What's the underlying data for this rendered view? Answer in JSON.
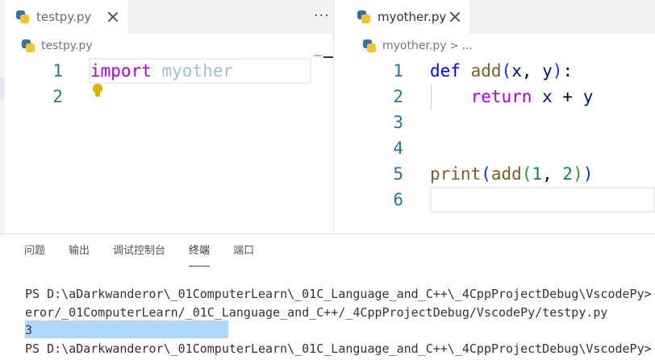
{
  "left_editor": {
    "tab_title": "testpy.py",
    "breadcrumb_file": "testpy.py",
    "more_icon": "···",
    "lines": [
      {
        "num": "1",
        "tokens": [
          {
            "t": "import",
            "c": "k-import"
          },
          {
            "t": " ",
            "c": ""
          },
          {
            "t": "myother",
            "c": "k-mod"
          }
        ]
      },
      {
        "num": "2",
        "tokens": []
      }
    ]
  },
  "right_editor": {
    "tab_title": "myother.py",
    "breadcrumb_file": "myother.py",
    "breadcrumb_sep": ">",
    "breadcrumb_more": "...",
    "lines": [
      {
        "num": "1",
        "tokens": [
          {
            "t": "def",
            "c": "k-def"
          },
          {
            "t": " ",
            "c": ""
          },
          {
            "t": "add",
            "c": "k-fn"
          },
          {
            "t": "(",
            "c": "k-paren1"
          },
          {
            "t": "x",
            "c": "k-var"
          },
          {
            "t": ", ",
            "c": "k-op"
          },
          {
            "t": "y",
            "c": "k-var"
          },
          {
            "t": ")",
            "c": "k-paren1"
          },
          {
            "t": ":",
            "c": "k-op"
          }
        ]
      },
      {
        "num": "2",
        "tokens": [
          {
            "t": "    ",
            "c": ""
          },
          {
            "t": "return",
            "c": "k-ret"
          },
          {
            "t": " ",
            "c": ""
          },
          {
            "t": "x",
            "c": "k-var"
          },
          {
            "t": " + ",
            "c": "k-op"
          },
          {
            "t": "y",
            "c": "k-var"
          }
        ]
      },
      {
        "num": "3",
        "tokens": []
      },
      {
        "num": "4",
        "tokens": []
      },
      {
        "num": "5",
        "tokens": [
          {
            "t": "print",
            "c": "k-fn"
          },
          {
            "t": "(",
            "c": "k-paren1"
          },
          {
            "t": "add",
            "c": "k-fn"
          },
          {
            "t": "(",
            "c": "k-paren2"
          },
          {
            "t": "1",
            "c": "k-num"
          },
          {
            "t": ", ",
            "c": "k-op"
          },
          {
            "t": "2",
            "c": "k-num"
          },
          {
            "t": ")",
            "c": "k-paren2"
          },
          {
            "t": ")",
            "c": "k-paren1"
          }
        ]
      },
      {
        "num": "6",
        "tokens": []
      }
    ]
  },
  "panel": {
    "tabs": [
      {
        "label": "问题",
        "name": "problems",
        "active": false
      },
      {
        "label": "输出",
        "name": "output",
        "active": false
      },
      {
        "label": "调试控制台",
        "name": "debug-console",
        "active": false
      },
      {
        "label": "终端",
        "name": "terminal",
        "active": true
      },
      {
        "label": "端口",
        "name": "ports",
        "active": false
      }
    ],
    "terminal_lines": [
      "PS D:\\aDarkwanderor\\_01ComputerLearn\\_01C_Language_and_C++\\_4CppProjectDebug\\VscodePy>",
      "eror/_01ComputerLearn/_01C_Language_and_C++/_4CppProjectDebug/VscodePy/testpy.py",
      "3",
      "PS D:\\aDarkwanderor\\_01ComputerLearn\\_01C_Language_and_C++\\_4CppProjectDebug\\VscodePy>"
    ]
  }
}
